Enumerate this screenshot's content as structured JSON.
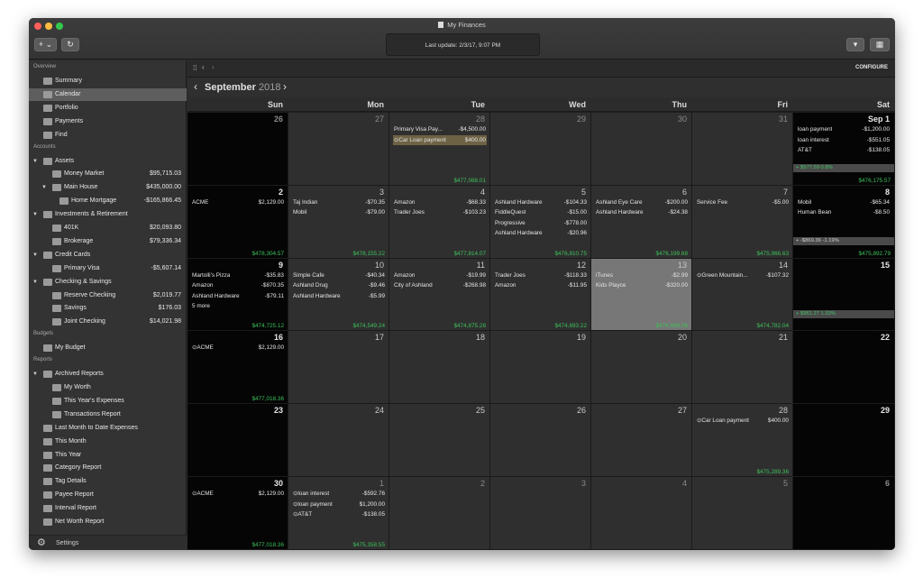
{
  "window": {
    "title": "My Finances",
    "last_update": "Last update: 2/3/17, 9:07 PM",
    "add_button": "+ ⌄",
    "refresh_icon": "refresh-icon"
  },
  "sidebar": {
    "overview_label": "Overview",
    "overview": [
      {
        "label": "Summary",
        "icon": "bank-icon"
      },
      {
        "label": "Calendar",
        "icon": "calendar-icon",
        "selected": true
      },
      {
        "label": "Portfolio",
        "icon": "portfolio-icon"
      },
      {
        "label": "Payments",
        "icon": "payments-icon"
      },
      {
        "label": "Find",
        "icon": "search-icon"
      }
    ],
    "accounts_label": "Accounts",
    "accounts": [
      {
        "label": "Assets",
        "level": 0,
        "group": true
      },
      {
        "label": "Money Market",
        "level": 1,
        "amount": "$95,715.03"
      },
      {
        "label": "Main House",
        "level": 1,
        "group": true,
        "amount": "$435,000.00"
      },
      {
        "label": "Home Mortgage",
        "level": 2,
        "amount": "-$165,866.45"
      },
      {
        "label": "Investments & Retirement",
        "level": 0,
        "group": true
      },
      {
        "label": "401K",
        "level": 1,
        "amount": "$20,093.80"
      },
      {
        "label": "Brokerage",
        "level": 1,
        "amount": "$79,336.34"
      },
      {
        "label": "Credit Cards",
        "level": 0,
        "group": true
      },
      {
        "label": "Primary Visa",
        "level": 1,
        "amount": "-$5,607.14"
      },
      {
        "label": "Checking & Savings",
        "level": 0,
        "group": true
      },
      {
        "label": "Reserve Checking",
        "level": 1,
        "amount": "$2,019.77"
      },
      {
        "label": "Savings",
        "level": 1,
        "amount": "$176.03"
      },
      {
        "label": "Joint Checking",
        "level": 1,
        "amount": "$14,021.98"
      }
    ],
    "budgets_label": "Budgets",
    "budgets": [
      {
        "label": "My Budget"
      }
    ],
    "reports_label": "Reports",
    "reports": [
      {
        "label": "Archived Reports",
        "level": 0,
        "group": true
      },
      {
        "label": "My Worth",
        "level": 1
      },
      {
        "label": "This Year's Expenses",
        "level": 1
      },
      {
        "label": "Transactions Report",
        "level": 1
      },
      {
        "label": "Last Month to Date Expenses",
        "level": 0
      },
      {
        "label": "This Month",
        "level": 0
      },
      {
        "label": "This Year",
        "level": 0
      },
      {
        "label": "Category Report",
        "level": 0
      },
      {
        "label": "Tag Details",
        "level": 0
      },
      {
        "label": "Payee Report",
        "level": 0
      },
      {
        "label": "Interval Report",
        "level": 0
      },
      {
        "label": "Net Worth Report",
        "level": 0
      }
    ],
    "settings": "Settings"
  },
  "calendar": {
    "configure": "CONFIGURE",
    "month": "September",
    "year": "2018",
    "days": [
      "Sun",
      "Mon",
      "Tue",
      "Wed",
      "Thu",
      "Fri",
      "Sat"
    ],
    "weeks": [
      {
        "band": {
          "text": "+ $577.59 0.8%",
          "positive": true
        },
        "cells": [
          {
            "day": "26",
            "other": true,
            "tx": []
          },
          {
            "day": "27",
            "other": true,
            "tx": []
          },
          {
            "day": "28",
            "other": true,
            "tx": [
              {
                "name": "Primary Visa Pay...",
                "amount": "-$4,500.00"
              },
              {
                "name": "⊙Car  Loan payment",
                "amount": "$400.00",
                "scheduled": true
              }
            ],
            "balance": "$477,088.01"
          },
          {
            "day": "29",
            "other": true,
            "tx": []
          },
          {
            "day": "30",
            "other": true,
            "tx": []
          },
          {
            "day": "31",
            "other": true,
            "tx": []
          },
          {
            "day": "Sep 1",
            "tx": [
              {
                "name": "loan payment",
                "amount": "-$1,200.00"
              },
              {
                "name": "loan interest",
                "amount": "-$551.05"
              },
              {
                "name": "AT&T",
                "amount": "-$138.05"
              }
            ],
            "balance": "$476,175.57"
          }
        ]
      },
      {
        "band": {
          "text": "+ -$869.36 -1.19%",
          "positive": false
        },
        "cells": [
          {
            "day": "2",
            "tx": [
              {
                "name": "ACME",
                "amount": "$2,129.00"
              }
            ],
            "balance": "$478,304.57"
          },
          {
            "day": "3",
            "tx": [
              {
                "name": "Taj Indian",
                "amount": "-$70.35"
              },
              {
                "name": "Mobil",
                "amount": "-$79.00"
              }
            ],
            "balance": "$478,155.22"
          },
          {
            "day": "4",
            "tx": [
              {
                "name": "Amazon",
                "amount": "-$68.33"
              },
              {
                "name": "Trader Joes",
                "amount": "-$103.23"
              }
            ],
            "balance": "$477,814.07"
          },
          {
            "day": "5",
            "tx": [
              {
                "name": "Ashland Hardware",
                "amount": "-$104.33"
              },
              {
                "name": "FiddleQuest",
                "amount": "-$15.00"
              },
              {
                "name": "Progressive",
                "amount": "-$778.00"
              },
              {
                "name": "Ashland Hardware",
                "amount": "-$20.96"
              }
            ],
            "balance": "$476,810.75"
          },
          {
            "day": "6",
            "tx": [
              {
                "name": "Ashland Eye Care",
                "amount": "-$200.00"
              },
              {
                "name": "Ashland Hardware",
                "amount": "-$24.38"
              }
            ],
            "balance": "$476,199.68"
          },
          {
            "day": "7",
            "tx": [
              {
                "name": "Service Fee",
                "amount": "-$5.00"
              }
            ],
            "balance": "$475,966.63"
          },
          {
            "day": "8",
            "tx": [
              {
                "name": "Mobil",
                "amount": "-$65.34"
              },
              {
                "name": "Human Bean",
                "amount": "-$8.50"
              }
            ],
            "balance": "$475,892.79"
          }
        ]
      },
      {
        "band": {
          "text": "+ $961.27 1.33%",
          "positive": true
        },
        "cells": [
          {
            "day": "9",
            "tx": [
              {
                "name": "Martolli's Pizza",
                "amount": "-$35.83"
              },
              {
                "name": "Amazon",
                "amount": "-$870.35"
              },
              {
                "name": "Ashland Hardware",
                "amount": "-$79.11"
              },
              {
                "name": "5 more",
                "amount": ""
              }
            ],
            "balance": "$474,725.12"
          },
          {
            "day": "10",
            "tx": [
              {
                "name": "Simple Cafe",
                "amount": "-$40.34"
              },
              {
                "name": "Ashland Drug",
                "amount": "-$9.46"
              },
              {
                "name": "Ashland Hardware",
                "amount": "-$5.99"
              }
            ],
            "balance": "$474,549.24"
          },
          {
            "day": "11",
            "tx": [
              {
                "name": "Amazon",
                "amount": "-$19.99"
              },
              {
                "name": "City of Ashland",
                "amount": "-$268.98"
              }
            ],
            "balance": "$474,875.26"
          },
          {
            "day": "12",
            "tx": [
              {
                "name": "Trader Joes",
                "amount": "-$118.33"
              },
              {
                "name": "Amazon",
                "amount": "-$11.95"
              }
            ],
            "balance": "$474,693.22"
          },
          {
            "day": "13",
            "selected": true,
            "tx": [
              {
                "name": "iTunes",
                "amount": "-$2.99"
              },
              {
                "name": "Kids Playce",
                "amount": "-$320.00"
              }
            ],
            "balance": "$474,689.06"
          },
          {
            "day": "14",
            "tx": [
              {
                "name": "⊙Green Mountain...",
                "amount": "-$107.32"
              }
            ],
            "balance": "$474,782.04"
          },
          {
            "day": "15",
            "tx": []
          }
        ]
      },
      {
        "cells": [
          {
            "day": "16",
            "tx": [
              {
                "name": "⊙ACME",
                "amount": "$2,129.00"
              }
            ],
            "balance": "$477,018.36"
          },
          {
            "day": "17",
            "tx": []
          },
          {
            "day": "18",
            "tx": []
          },
          {
            "day": "19",
            "tx": []
          },
          {
            "day": "20",
            "tx": []
          },
          {
            "day": "21",
            "tx": []
          },
          {
            "day": "22",
            "tx": []
          }
        ]
      },
      {
        "cells": [
          {
            "day": "23",
            "tx": []
          },
          {
            "day": "24",
            "tx": []
          },
          {
            "day": "25",
            "tx": []
          },
          {
            "day": "26",
            "tx": []
          },
          {
            "day": "27",
            "tx": []
          },
          {
            "day": "28",
            "tx": [
              {
                "name": "⊙Car  Loan payment",
                "amount": "$400.00"
              }
            ],
            "balance": "$475,289.36"
          },
          {
            "day": "29",
            "tx": []
          }
        ]
      },
      {
        "cells": [
          {
            "day": "30",
            "tx": [
              {
                "name": "⊙ACME",
                "amount": "$2,129.00"
              }
            ],
            "balance": "$477,018.36"
          },
          {
            "day": "1",
            "other": true,
            "tx": [
              {
                "name": "⊙loan interest",
                "amount": "-$592.76"
              },
              {
                "name": "⊙loan payment",
                "amount": "$1,200.00"
              },
              {
                "name": "⊙AT&T",
                "amount": "-$138.05"
              }
            ],
            "balance": "$475,358.55"
          },
          {
            "day": "2",
            "other": true,
            "tx": []
          },
          {
            "day": "3",
            "other": true,
            "tx": []
          },
          {
            "day": "4",
            "other": true,
            "tx": []
          },
          {
            "day": "5",
            "other": true,
            "tx": []
          },
          {
            "day": "6",
            "other": true,
            "tx": []
          }
        ]
      }
    ]
  }
}
